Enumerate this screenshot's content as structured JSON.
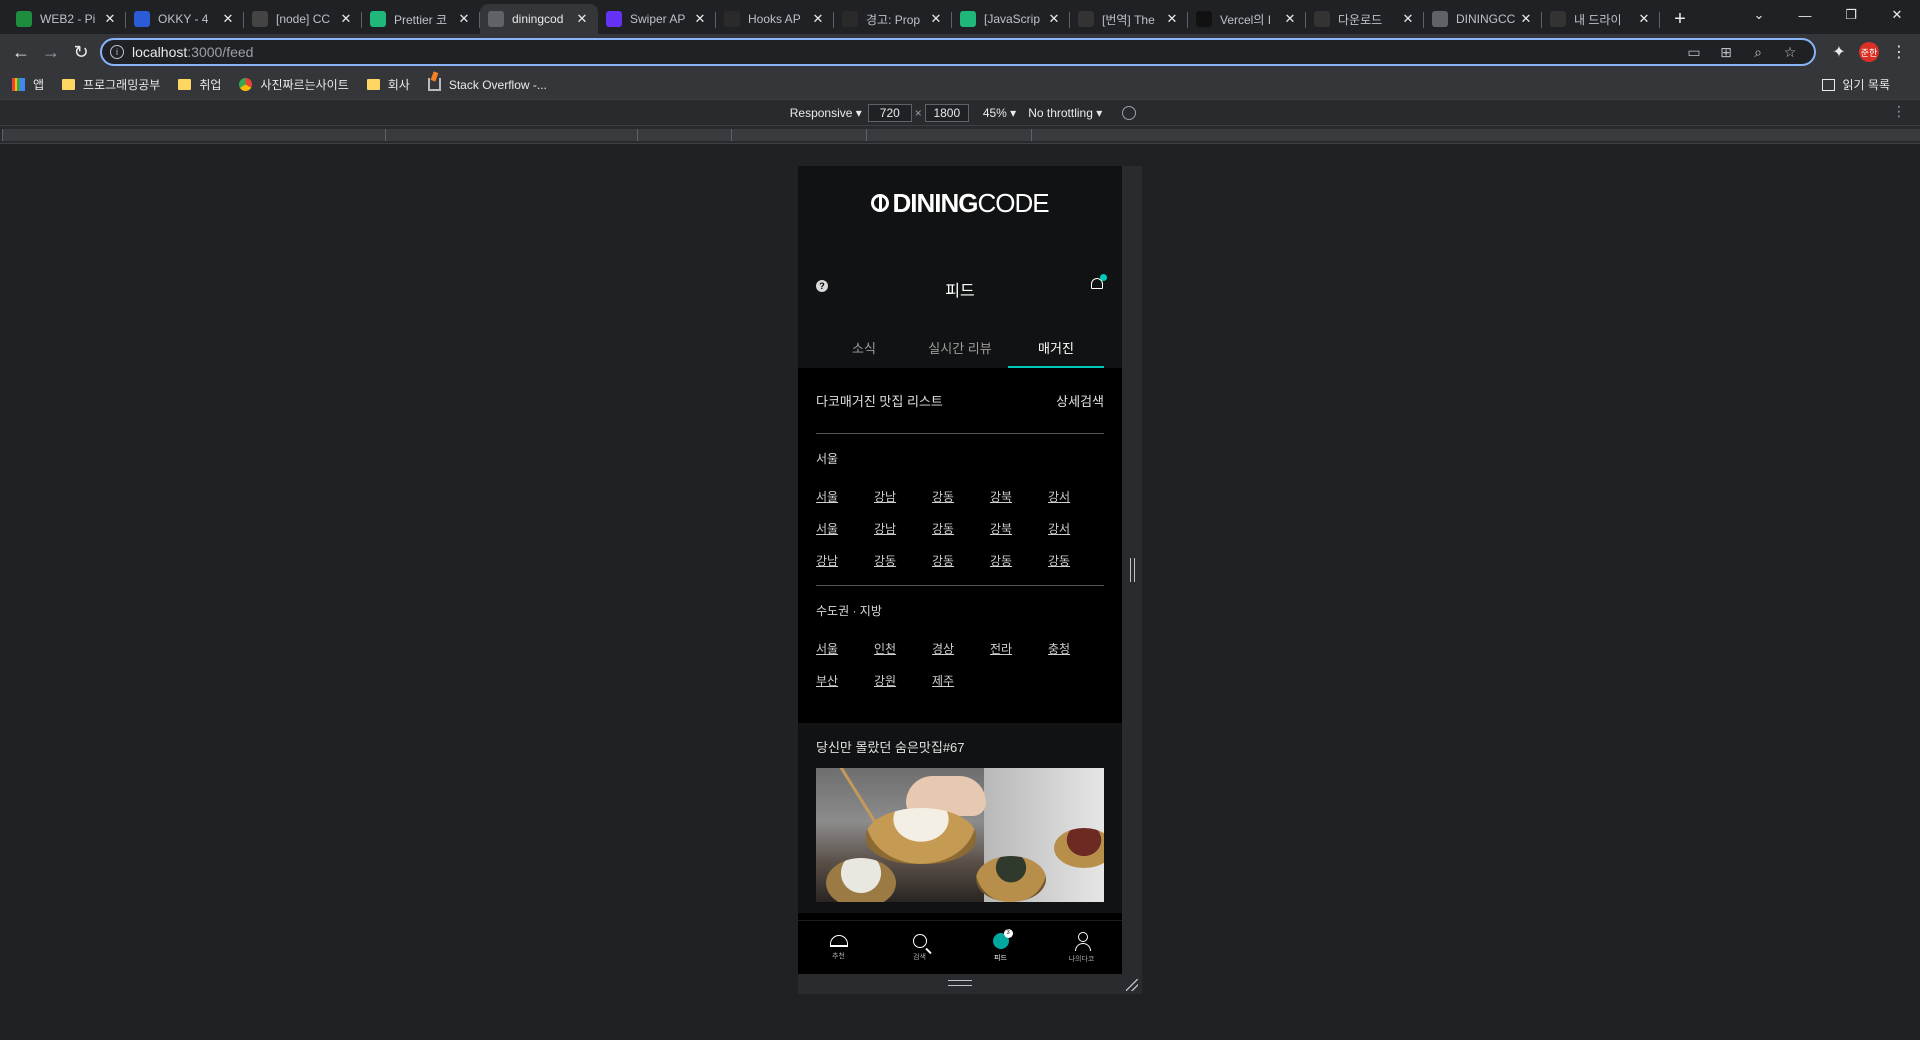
{
  "browser": {
    "tabs": [
      {
        "title": "WEB2 - Pi",
        "icon": "web-icon",
        "color": "#1e8e3e"
      },
      {
        "title": "OKKY - 4",
        "icon": "okky-icon",
        "color": "#2b5bd7"
      },
      {
        "title": "[node] CC",
        "icon": "terminal-icon",
        "color": "#444"
      },
      {
        "title": "Prettier 코",
        "icon": "v-icon",
        "color": "#1fb87a"
      },
      {
        "title": "diningcod",
        "icon": "globe-icon",
        "color": "#5f6368"
      },
      {
        "title": "Swiper AP",
        "icon": "swiper-icon",
        "color": "#6332f6"
      },
      {
        "title": "Hooks AP",
        "icon": "react-icon",
        "color": "#2a2a2a"
      },
      {
        "title": "경고: Prop",
        "icon": "github-icon",
        "color": "#2a2a2a"
      },
      {
        "title": "[JavaScrip",
        "icon": "v-icon",
        "color": "#1fb87a"
      },
      {
        "title": "[번역] The",
        "icon": "dot-icon",
        "color": "#333"
      },
      {
        "title": "Vercel의 I",
        "icon": "notion-icon",
        "color": "#111"
      },
      {
        "title": "다운로드",
        "icon": "download-icon",
        "color": "#333"
      },
      {
        "title": "DININGCC",
        "icon": "globe-icon",
        "color": "#5f6368"
      },
      {
        "title": "내 드라이",
        "icon": "drive-icon",
        "color": "#333"
      }
    ],
    "address": {
      "host": "localhost",
      "path": ":3000/feed"
    },
    "profile_initials": "준한",
    "bookmarks": [
      {
        "label": "앱",
        "type": "apps"
      },
      {
        "label": "프로그래밍공부",
        "type": "folder"
      },
      {
        "label": "취업",
        "type": "folder"
      },
      {
        "label": "사진짜르는사이트",
        "type": "chrome"
      },
      {
        "label": "회사",
        "type": "folder"
      },
      {
        "label": "Stack Overflow -...",
        "type": "so"
      }
    ],
    "reading_list": "읽기 목록"
  },
  "devtools": {
    "device": "Responsive",
    "width": "720",
    "height": "1800",
    "zoom": "45%",
    "throttle": "No throttling"
  },
  "app": {
    "logo_bold": "DINING",
    "logo_light": "CODE",
    "help": "?",
    "page_title": "피드",
    "tabs": [
      "소식",
      "실시간 리뷰",
      "매거진"
    ],
    "active_tab": 2,
    "magazine": {
      "title": "다코매거진 맛집 리스트",
      "detail_search": "상세검색",
      "seoul_title": "서울",
      "seoul_links": [
        "서울",
        "강남",
        "강동",
        "강북",
        "강서",
        "서울",
        "강남",
        "강동",
        "강북",
        "강서",
        "강남",
        "강동",
        "강동",
        "강동",
        "강동"
      ],
      "regional_title": "수도권 · 지방",
      "regional_links": [
        "서울",
        "인천",
        "경상",
        "전라",
        "충청",
        "부산",
        "강원",
        "제주"
      ]
    },
    "hidden_card_title": "당신만 몰랐던 숨은맛집#67",
    "bottom_nav": [
      {
        "label": "추천",
        "icon": "home-icon"
      },
      {
        "label": "검색",
        "icon": "search-icon"
      },
      {
        "label": "피드",
        "icon": "feed-icon",
        "badge": "3"
      },
      {
        "label": "나의다코",
        "icon": "user-icon"
      }
    ],
    "accent": "#00c9b7"
  }
}
